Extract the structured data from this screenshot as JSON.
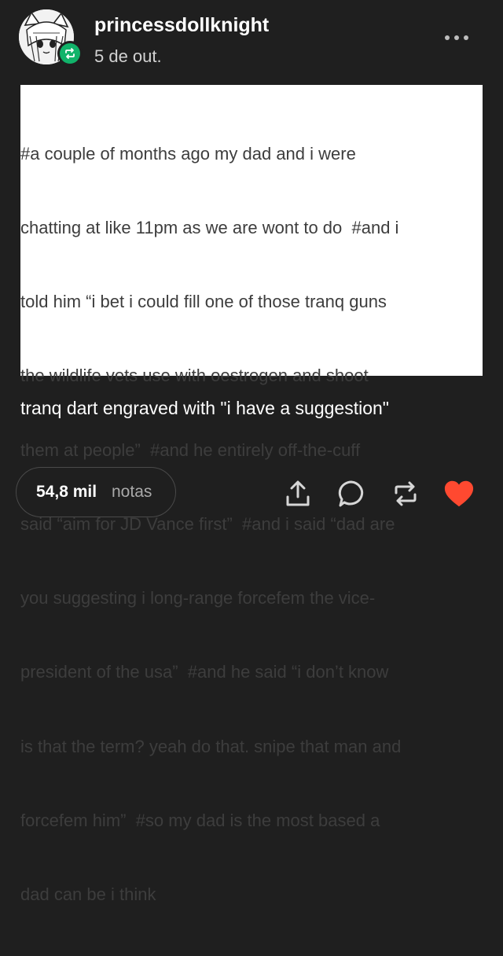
{
  "post": {
    "username": "princessdollknight",
    "date": "5 de out.",
    "tags_lines": [
      "#a couple of months ago my dad and i were",
      "chatting at like 11pm as we are wont to do  #and i",
      "told him “i bet i could fill one of those tranq guns",
      "the wildlife vets use with oestrogen and shoot",
      "them at people”  #and he entirely off-the-cuff",
      "said “aim for JD Vance first”  #and i said “dad are",
      "you suggesting i long-range forcefem the vice-",
      "president of the usa”  #and he said “i don’t know",
      "is that the term? yeah do that. snipe that man and",
      "forcefem him”  #so my dad is the most based a",
      "dad can be i think"
    ],
    "caption": "tranq dart engraved with \"i have a suggestion\""
  },
  "footer": {
    "notes_count": "54,8 mil",
    "notes_label": "notas"
  },
  "icons": {
    "avatar": "avatar-anime-icon",
    "reblog_badge": "reblog-icon",
    "more": "more-dots-icon",
    "share": "share-icon",
    "reply": "reply-icon",
    "reblog": "reblog-icon",
    "like": "heart-icon"
  },
  "colors": {
    "background": "#1f1f1f",
    "tags_panel": "#ffffff",
    "reblog_green": "#11b36a",
    "like_red": "#ff4930",
    "icon_grey": "#d6d6d6"
  }
}
